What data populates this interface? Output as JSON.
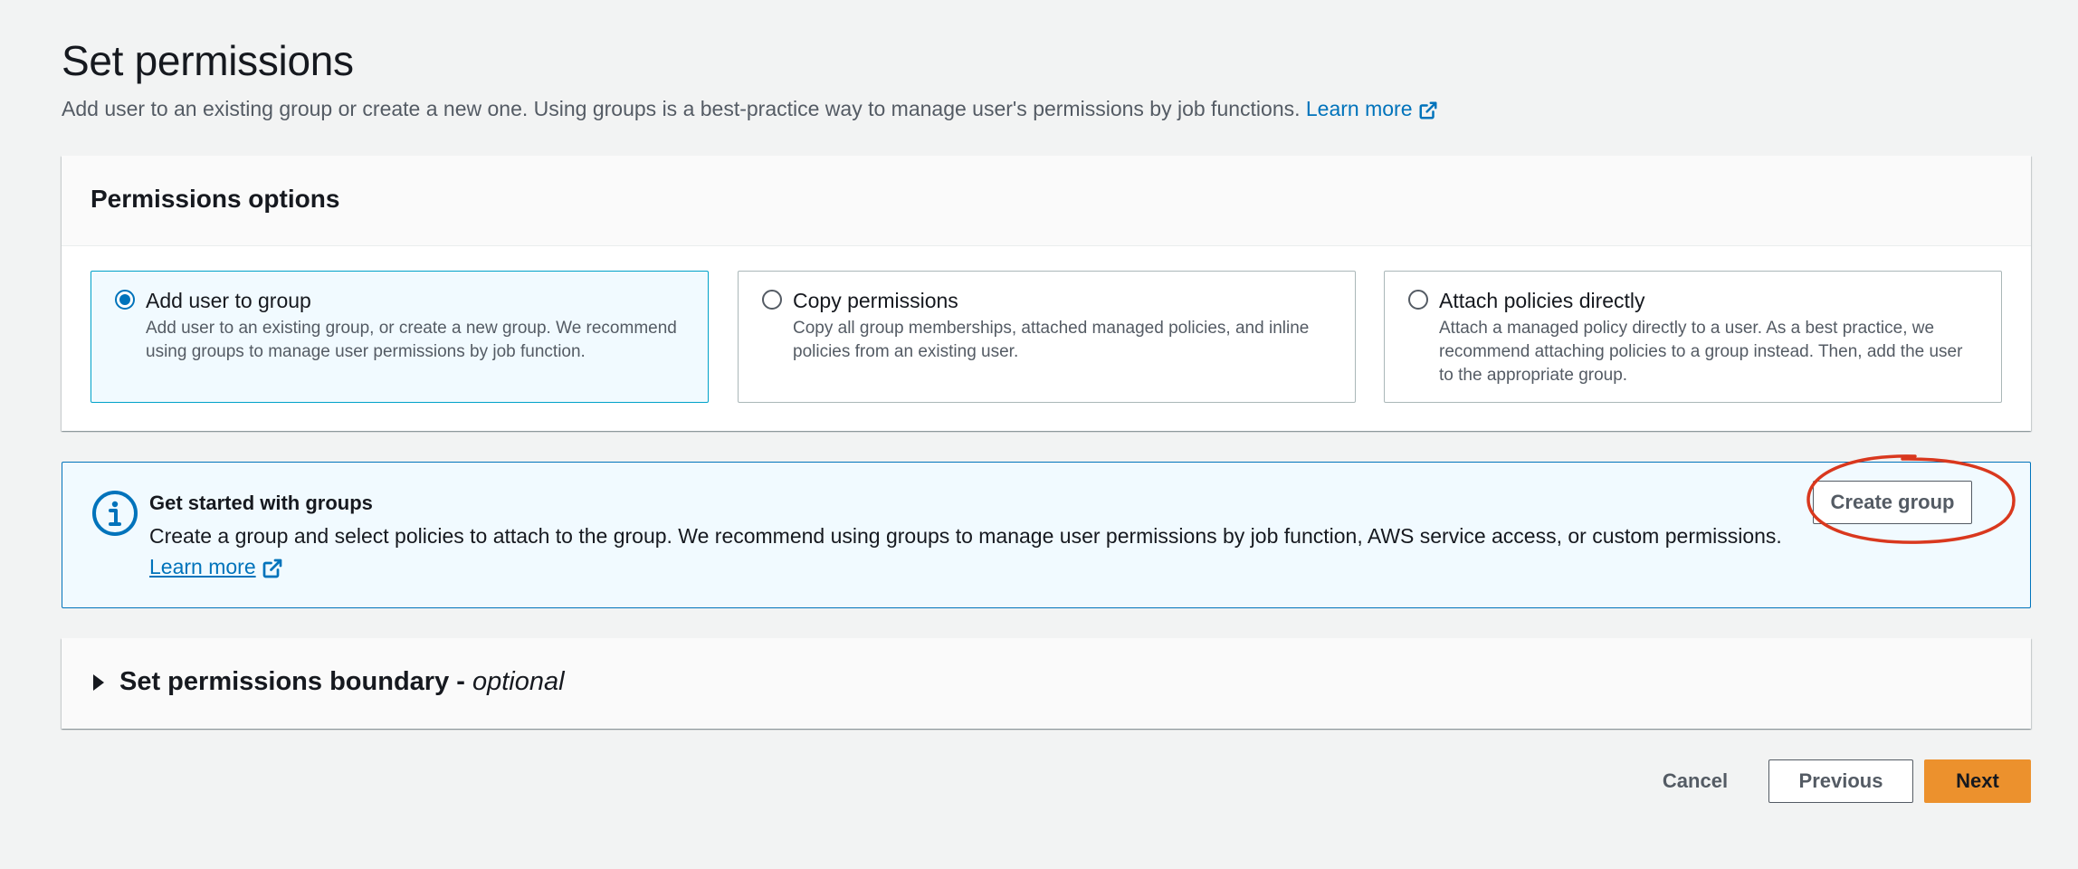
{
  "header": {
    "title": "Set permissions",
    "description": "Add user to an existing group or create a new one. Using groups is a best-practice way to manage user's permissions by job functions.",
    "learn_more": "Learn more"
  },
  "permissions_options": {
    "title": "Permissions options",
    "options": [
      {
        "label": "Add user to group",
        "description": "Add user to an existing group, or create a new group. We recommend using groups to manage user permissions by job function.",
        "selected": true
      },
      {
        "label": "Copy permissions",
        "description": "Copy all group memberships, attached managed policies, and inline policies from an existing user.",
        "selected": false
      },
      {
        "label": "Attach policies directly",
        "description": "Attach a managed policy directly to a user. As a best practice, we recommend attaching policies to a group instead. Then, add the user to the appropriate group.",
        "selected": false
      }
    ]
  },
  "groups_alert": {
    "title": "Get started with groups",
    "body": "Create a group and select policies to attach to the group. We recommend using groups to manage user permissions by job function, AWS service access, or custom permissions.",
    "learn_more": "Learn more",
    "create_group_label": "Create group"
  },
  "boundary_section": {
    "title": "Set permissions boundary - ",
    "optional": "optional"
  },
  "footer": {
    "cancel_label": "Cancel",
    "previous_label": "Previous",
    "next_label": "Next"
  },
  "colors": {
    "link": "#0073bb",
    "primary_button": "#ec912d",
    "selected_tile_bg": "#f1faff",
    "annotation_circle": "#d9381e"
  },
  "icons": [
    "external-link-icon",
    "info-icon",
    "caret-right-icon",
    "radio-selected-icon",
    "radio-empty-icon"
  ]
}
